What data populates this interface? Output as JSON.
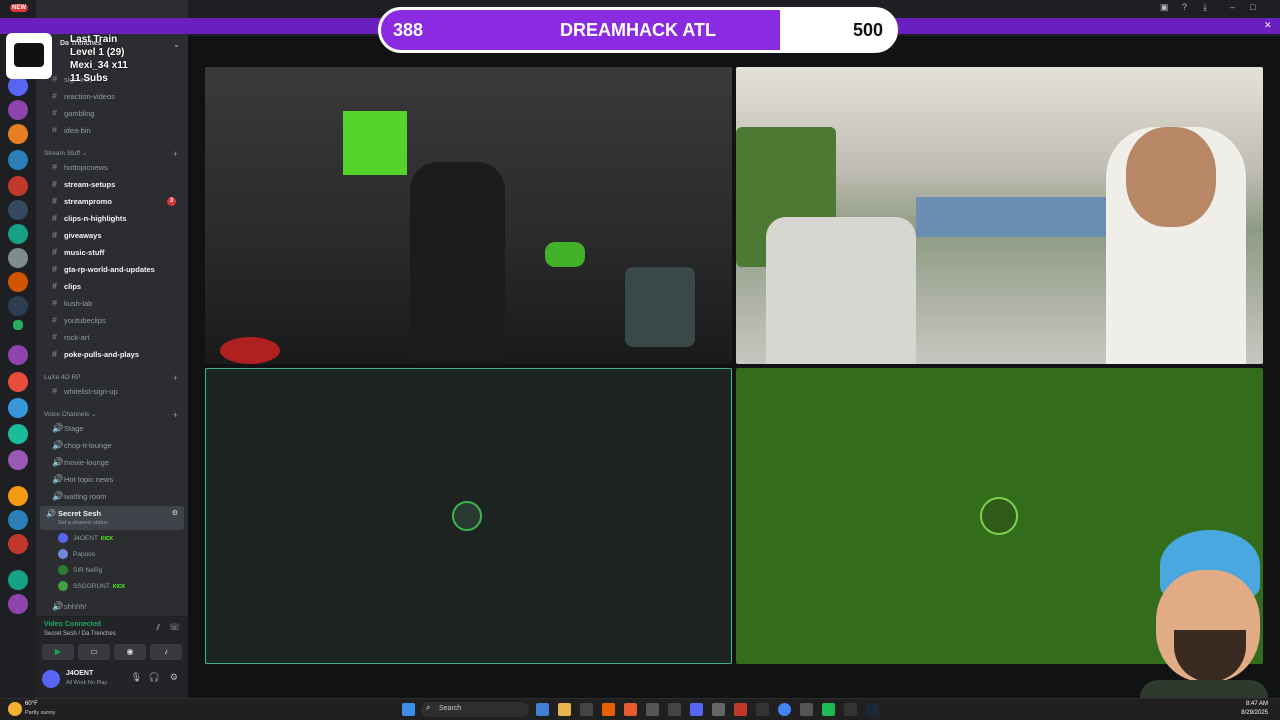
{
  "overlay": {
    "progress_current": "388",
    "progress_title": "DREAMHACK ATL",
    "progress_goal": "500",
    "progress_fraction": 0.776,
    "alert_title": "Last Train",
    "alert_level": "Level 1 (29)",
    "alert_user": "Mexi_34 x11",
    "alert_subs": "11 Subs",
    "new_badge": "NEW"
  },
  "server_header": "Da Trenches",
  "channels": [
    {
      "name": "sign-info",
      "bold": false
    },
    {
      "name": "reaction-videos",
      "bold": false
    },
    {
      "name": "gambling",
      "bold": false
    },
    {
      "name": "idea-bin",
      "bold": false
    }
  ],
  "cat_stream": "Stream Stuff",
  "stream_channels": [
    {
      "name": "hottopicnews",
      "bold": false,
      "badge": ""
    },
    {
      "name": "stream-setups",
      "bold": true,
      "badge": ""
    },
    {
      "name": "streampromo",
      "bold": true,
      "badge": "3"
    },
    {
      "name": "clips-n-highlights",
      "bold": true,
      "badge": ""
    },
    {
      "name": "giveaways",
      "bold": true,
      "badge": ""
    },
    {
      "name": "music-stuff",
      "bold": true,
      "badge": ""
    },
    {
      "name": "gta-rp-world-and-updates",
      "bold": true,
      "badge": ""
    },
    {
      "name": "clips",
      "bold": true,
      "badge": ""
    },
    {
      "name": "kush-lab",
      "bold": false,
      "badge": ""
    },
    {
      "name": "youtubeclips",
      "bold": false,
      "badge": ""
    },
    {
      "name": "rock-art",
      "bold": false,
      "badge": ""
    },
    {
      "name": "poke-pulls-and-plays",
      "bold": true,
      "badge": ""
    }
  ],
  "cat_luxe": "LuXe 4O RP",
  "luxe_channels": [
    {
      "name": "whitelist-sign-up"
    }
  ],
  "cat_voice": "Voice Channels",
  "voice_channels": [
    {
      "name": "Stage"
    },
    {
      "name": "chop-it-lounge"
    },
    {
      "name": "movie-lounge"
    },
    {
      "name": "Hot topic news"
    },
    {
      "name": "waiting room"
    }
  ],
  "active_voice": {
    "name": "Secret Sesh",
    "status": "Set a channel status"
  },
  "voice_users": [
    {
      "name": "J4OENT",
      "kick": "KICK",
      "color": "#5865f2"
    },
    {
      "name": "Papooo",
      "kick": "",
      "color": "#7289da"
    },
    {
      "name": "SIR NeRg",
      "kick": "",
      "color": "#2e7d32"
    },
    {
      "name": "SSGGRUNT",
      "kick": "KICK",
      "color": "#43a047"
    }
  ],
  "last_channel": "shhhh!",
  "connection": {
    "status": "Video Connected",
    "location": "Secret Sesh / Da Trenches"
  },
  "user": {
    "name": "J4OENT",
    "status": "All Work No Play"
  },
  "taskbar": {
    "weather_temp": "60°F",
    "weather_desc": "Partly sunny",
    "search_placeholder": "Search",
    "time": "8:47 AM",
    "date": "8/29/2025"
  },
  "colors": {
    "progress_fill": "#8a2be2",
    "progress_bg": "#ffffff",
    "discord_bg": "#2b2d31",
    "tile_dark": "#1d2421",
    "tile_green": "#336d1b",
    "tile_border": "#43b581"
  }
}
